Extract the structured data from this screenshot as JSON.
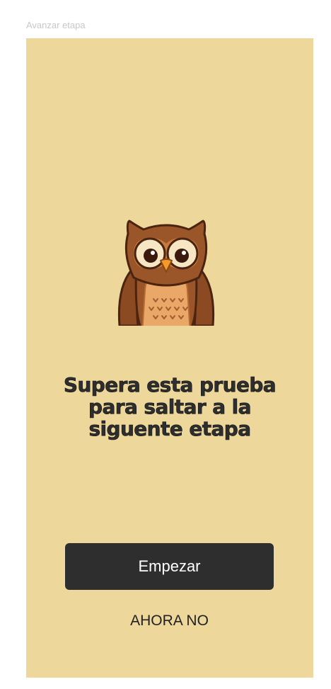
{
  "header": {
    "caption": "Avanzar etapa"
  },
  "screen": {
    "background": "#edd79b",
    "illustration": "owl-mascot",
    "headline": "Supera esta prueba para saltar a la siguente etapa",
    "start_label": "Empezar",
    "later_label": "AHORA NO",
    "button_color": "#2e2e2e"
  }
}
